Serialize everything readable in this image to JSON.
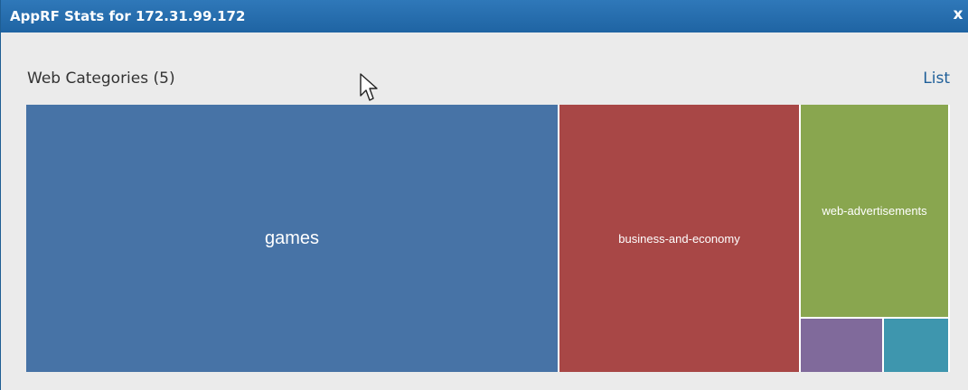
{
  "window": {
    "title": "AppRF Stats for 172.31.99.172",
    "close_label": "x"
  },
  "panel": {
    "title": "Web Categories (5)",
    "list_link": "List"
  },
  "treemap": {
    "tiles": [
      {
        "label": "games",
        "color": "#4773a6"
      },
      {
        "label": "business-and-economy",
        "color": "#a84746"
      },
      {
        "label": "web-advertisements",
        "color": "#89a64f"
      },
      {
        "label": "",
        "color": "#806a9b"
      },
      {
        "label": "",
        "color": "#3e96ae"
      }
    ]
  }
}
